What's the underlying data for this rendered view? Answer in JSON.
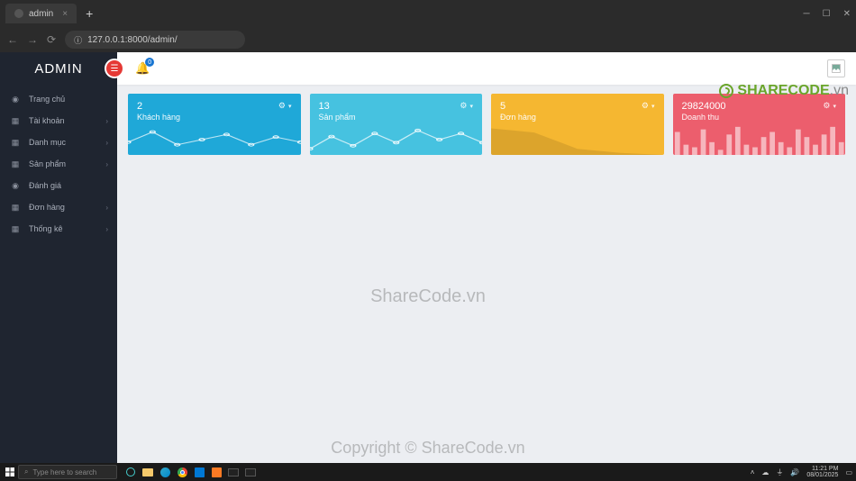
{
  "browser": {
    "tab_title": "admin",
    "url": "127.0.0.1:8000/admin/",
    "new_tab_glyph": "+"
  },
  "sidebar": {
    "brand": "ADMIN",
    "items": [
      {
        "icon": "gauge",
        "label": "Trang chủ",
        "expandable": false
      },
      {
        "icon": "grid",
        "label": "Tài khoản",
        "expandable": true
      },
      {
        "icon": "grid",
        "label": "Danh mục",
        "expandable": true
      },
      {
        "icon": "grid",
        "label": "Sản phẩm",
        "expandable": true
      },
      {
        "icon": "gauge",
        "label": "Đánh giá",
        "expandable": false
      },
      {
        "icon": "grid",
        "label": "Đơn hàng",
        "expandable": true
      },
      {
        "icon": "grid",
        "label": "Thống kê",
        "expandable": true
      }
    ]
  },
  "topbar": {
    "notifications_count": "0"
  },
  "cards": [
    {
      "value": "2",
      "label": "Khách hàng",
      "color": "c1",
      "spark_type": "line"
    },
    {
      "value": "13",
      "label": "Sản phẩm",
      "color": "c2",
      "spark_type": "line"
    },
    {
      "value": "5",
      "label": "Đơn hàng",
      "color": "c3",
      "spark_type": "area"
    },
    {
      "value": "29824000",
      "label": "Doanh thu",
      "color": "c4",
      "spark_type": "bars"
    }
  ],
  "watermark": {
    "center": "ShareCode.vn",
    "bottom": "Copyright © ShareCode.vn",
    "logo_main": "SHARECODE",
    "logo_suffix": ".vn"
  },
  "taskbar": {
    "search_placeholder": "Type here to search",
    "time": "11:21 PM",
    "date": "08/01/2025"
  },
  "chart_data": [
    {
      "type": "line",
      "values": [
        20,
        28,
        18,
        22,
        26,
        18,
        24,
        20
      ],
      "ylim": [
        10,
        34
      ]
    },
    {
      "type": "line",
      "values": [
        14,
        22,
        16,
        24,
        18,
        26,
        20,
        24,
        18
      ],
      "ylim": [
        10,
        30
      ]
    },
    {
      "type": "area",
      "values": [
        26,
        24,
        22,
        14,
        6,
        4,
        2,
        1,
        0
      ],
      "ylim": [
        0,
        30
      ]
    },
    {
      "type": "bar",
      "values": [
        18,
        8,
        6,
        20,
        10,
        4,
        16,
        22,
        8,
        6,
        14,
        18,
        10,
        6,
        20,
        14,
        8,
        16,
        22,
        10
      ],
      "ylim": [
        0,
        24
      ]
    }
  ]
}
